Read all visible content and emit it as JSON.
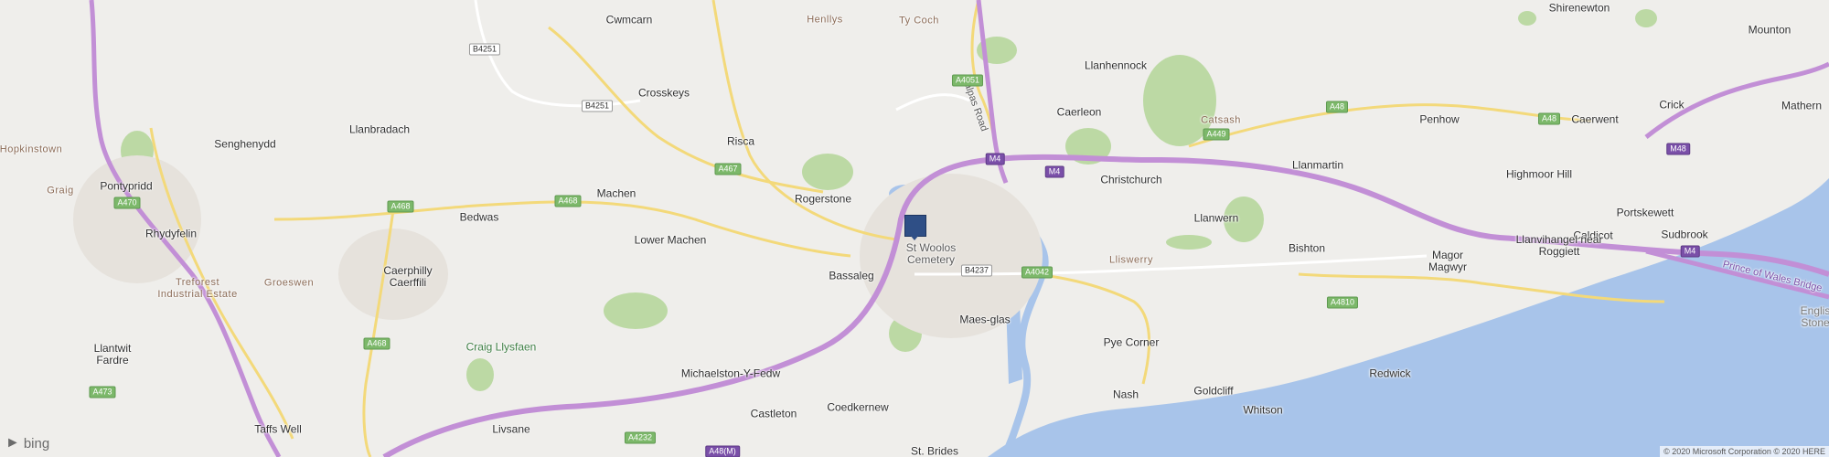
{
  "map": {
    "provider": "bing",
    "copyright": "© 2020 Microsoft Corporation © 2020 HERE",
    "colors": {
      "land": "#efeeeb",
      "water": "#a8c4ea",
      "park": "#bcd9a4",
      "motorway": "#c28fd6",
      "a_road": "#f3d97a",
      "b_road": "#ffffff",
      "marker": "#2f4f86"
    },
    "marker": {
      "label": "location-pin"
    },
    "places": [
      "Cwmcarn",
      "Henllys",
      "Ty Coch",
      "Shirenewton",
      "Mounton",
      "Llanhennock",
      "Crosskeys",
      "Llanbradach",
      "Caerleon",
      "Catsash",
      "Penhow",
      "Caerwent",
      "Crick",
      "Mathern",
      "Hopkinstown",
      "Senghenydd",
      "Risca",
      "Christchurch",
      "Llanmartin",
      "Highmoor Hill",
      "Graig",
      "Pontypridd",
      "Machen",
      "Rogerstone",
      "Portskewett",
      "Rhydyfelin",
      "Bedwas",
      "Llanwern",
      "Caldicot",
      "Lower Machen",
      "St Woolos Cemetery",
      "Bishton",
      "Sudbrook",
      "Lliswerry",
      "Magor Magwyr",
      "Llanvihangel near Roggiett",
      "Treforest Industrial Estate",
      "Groeswen",
      "Caerphilly Caerffili",
      "Bassaleg",
      "Maes-glas",
      "Englis Stone",
      "Pye Corner",
      "Llantwit Fardre",
      "Craig Llysfaen",
      "Michaelston-Y-Fedw",
      "Nash",
      "Goldcliff",
      "Redwick",
      "Whitson",
      "Castleton",
      "Coedkernew",
      "Taffs Well",
      "Livsane",
      "St. Brides",
      "Prince of Wales Bridge",
      "Malpas Road"
    ],
    "road_shields": [
      "B4251",
      "B4251",
      "A4051",
      "A467",
      "M4",
      "M4",
      "A449",
      "A48",
      "A48",
      "A470",
      "A468",
      "A468",
      "A4042",
      "B4237",
      "A4810",
      "M4",
      "M48",
      "A468",
      "A473",
      "A4232",
      "A48(M)"
    ]
  }
}
